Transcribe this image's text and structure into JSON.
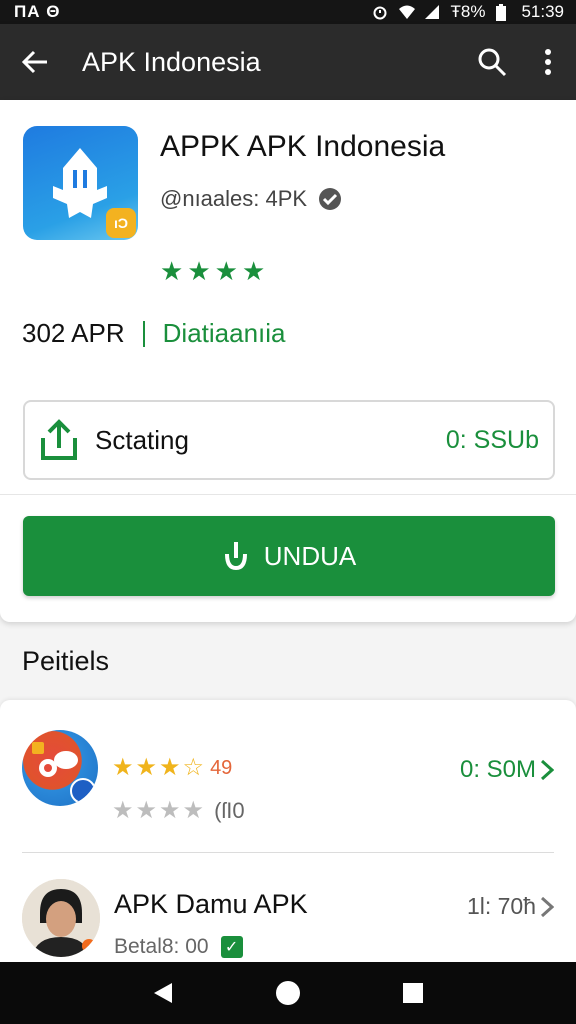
{
  "status_bar": {
    "left_text": "ΠΑ Θ",
    "battery": "Ŧ8%",
    "time": "51:39"
  },
  "app_bar": {
    "title": "APK Indonesia",
    "icons": [
      "back-arrow-icon",
      "search-icon",
      "more-vert-icon"
    ]
  },
  "app": {
    "name": "APPK APK Indonesia",
    "developer": "@nıaales: 4PK",
    "icon_badge": "ıƆ",
    "rating_stars": 4,
    "size": "302 APR",
    "category": "Diatiaanıia"
  },
  "storage": {
    "label": "Sctating",
    "value": "0: SSUb"
  },
  "download_button": {
    "label": "UNDUA"
  },
  "section": {
    "title": "Peitiels"
  },
  "list": [
    {
      "stars_text": "49",
      "sub_count": "(ſI0",
      "size": "0: S0M"
    },
    {
      "name": "APK Damu APK",
      "sub": "Betal8: 00",
      "size": "1l: 70ħ"
    }
  ],
  "colors": {
    "accent": "#1a8f3c",
    "appbar": "#2b2b2b",
    "star_gold": "#f0b41c"
  }
}
